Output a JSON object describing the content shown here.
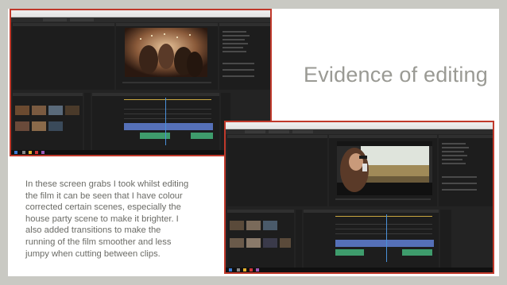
{
  "slide": {
    "title": "Evidence of editing",
    "body_lines": [
      "In these screen grabs I took whilst editing",
      "the film it can be seen that I have colour",
      "corrected certain scenes, especially the",
      "house party scene to make it brighter. I",
      "also added transitions to make the",
      "running of the film smoother and less",
      "jumpy when cutting between clips."
    ]
  },
  "screenshots": [
    {
      "id": "screenshot-house-party",
      "border_color": "#c0392b"
    },
    {
      "id": "screenshot-car-scene",
      "border_color": "#c0392b"
    }
  ],
  "colors": {
    "background": "#c9c9c3",
    "slide": "#ffffff",
    "title_text": "#9a9a94",
    "body_text": "#6b6b66",
    "video_track": "#5570b8",
    "audio_track": "#3e9c6c"
  }
}
